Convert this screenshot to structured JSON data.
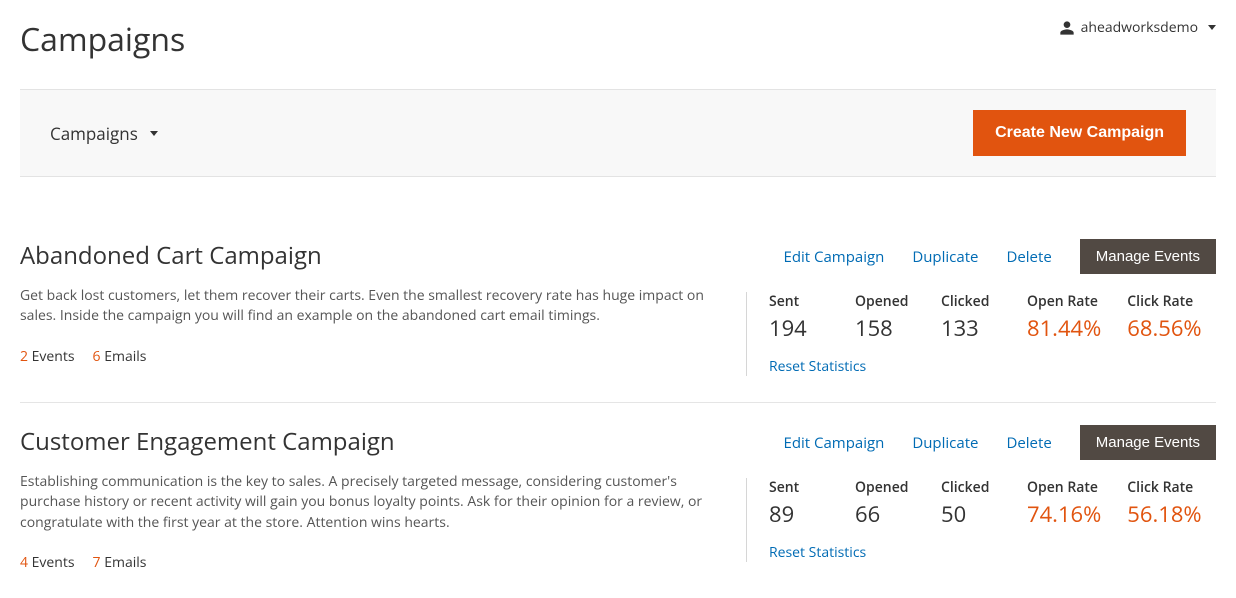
{
  "page": {
    "title": "Campaigns",
    "user_name": "aheadworksdemo"
  },
  "toolbar": {
    "dropdown_label": "Campaigns",
    "create_button": "Create New Campaign"
  },
  "labels": {
    "events": "Events",
    "emails": "Emails",
    "edit": "Edit Campaign",
    "duplicate": "Duplicate",
    "delete": "Delete",
    "manage": "Manage Events",
    "sent": "Sent",
    "opened": "Opened",
    "clicked": "Clicked",
    "open_rate": "Open Rate",
    "click_rate": "Click Rate",
    "reset": "Reset Statistics"
  },
  "campaigns": [
    {
      "title": "Abandoned Cart Campaign",
      "description": "Get back lost customers, let them recover their carts. Even the smallest recovery rate has huge impact on sales. Inside the campaign you will find an example on the abandoned cart email timings.",
      "events": "2",
      "emails": "6",
      "sent": "194",
      "opened": "158",
      "clicked": "133",
      "open_rate": "81.44%",
      "click_rate": "68.56%"
    },
    {
      "title": "Customer Engagement Campaign",
      "description": "Establishing communication is the key to sales. A precisely targeted message, considering customer's purchase history or recent activity will gain you bonus loyalty points. Ask for their opinion for a review, or congratulate with the first year at the store. Attention wins hearts.",
      "events": "4",
      "emails": "7",
      "sent": "89",
      "opened": "66",
      "clicked": "50",
      "open_rate": "74.16%",
      "click_rate": "56.18%"
    }
  ]
}
